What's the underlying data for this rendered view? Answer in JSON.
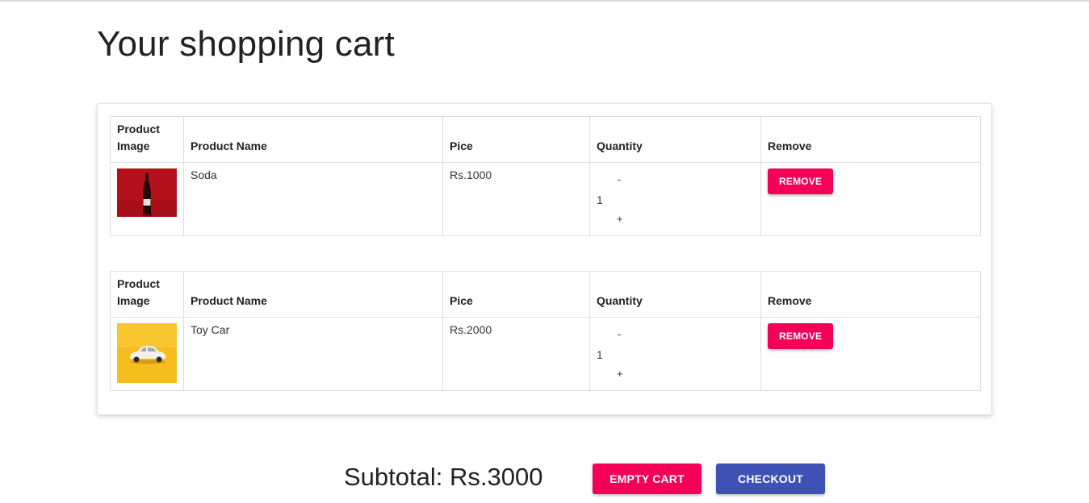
{
  "page": {
    "title": "Your shopping cart"
  },
  "table_headers": {
    "image": "Product Image",
    "name": "Product Name",
    "price": "Pice",
    "quantity": "Quantity",
    "remove": "Remove"
  },
  "items": [
    {
      "image_icon": "soda-bottle-image",
      "image_bg": "#b3121c",
      "name": "Soda",
      "price": "Rs.1000",
      "qty_minus": "-",
      "quantity": "1",
      "qty_plus": "+",
      "remove_label": "REMOVE"
    },
    {
      "image_icon": "toy-car-image",
      "image_bg": "#f6bd1f",
      "name": "Toy Car",
      "price": "Rs.2000",
      "qty_minus": "-",
      "quantity": "1",
      "qty_plus": "+",
      "remove_label": "REMOVE"
    }
  ],
  "footer": {
    "subtotal": "Subtotal: Rs.3000",
    "empty_cart_label": "EMPTY CART",
    "checkout_label": "CHECKOUT"
  },
  "colors": {
    "accent_pink": "#f50057",
    "primary_indigo": "#3f51b5"
  }
}
